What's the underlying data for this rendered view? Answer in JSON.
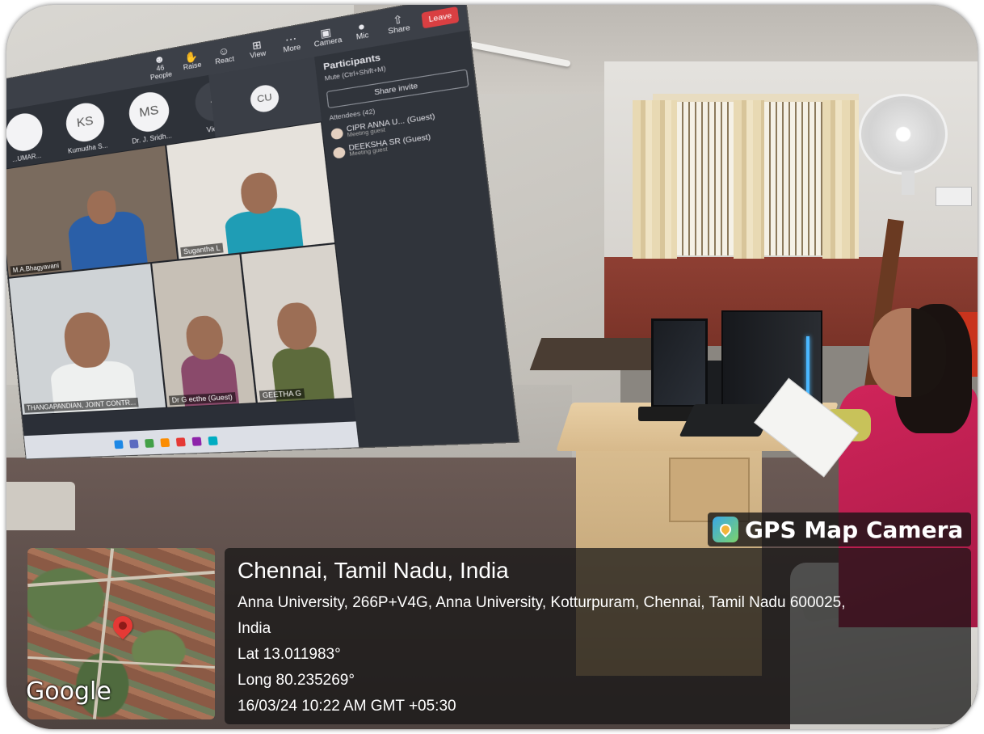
{
  "projected_meeting": {
    "toolbar": {
      "people": "People",
      "people_count": "46",
      "raise": "Raise",
      "react": "React",
      "view": "View",
      "more": "More",
      "camera": "Camera",
      "mic": "Mic",
      "share": "Share",
      "leave": "Leave"
    },
    "avatars": [
      {
        "initials": "",
        "name": "...UMAR..."
      },
      {
        "initials": "KS",
        "name": "Kumudha S..."
      },
      {
        "initials": "MS",
        "name": "Dr. J. Sridh..."
      },
      {
        "initials": "···",
        "name": "View all"
      }
    ],
    "cu_initials": "CU",
    "video_tiles": [
      {
        "label": "M.A.Bhagyavani"
      },
      {
        "label": "Sugantha L"
      },
      {
        "label": "THANGAPANDIAN, JOINT CONTR..."
      },
      {
        "label": "Dr G ecthe (Guest)"
      },
      {
        "label": "GEETHA G"
      }
    ],
    "participants": {
      "title": "Participants",
      "tooltip": "Mute (Ctrl+Shift+M)",
      "share_invite": "Share invite",
      "attendees_header": "Attendees (42)",
      "attendees": [
        {
          "name": "CIPR ANNA U... (Guest)",
          "role": "Meeting guest"
        },
        {
          "name": "DEEKSHA SR (Guest)",
          "role": "Meeting guest"
        }
      ]
    }
  },
  "gps_overlay": {
    "badge": "GPS Map Camera",
    "city": "Chennai, Tamil Nadu, India",
    "address_line1": "Anna University, 266P+V4G, Anna University, Kotturpuram, Chennai, Tamil Nadu 600025,",
    "address_line2": "India",
    "lat": "Lat 13.011983°",
    "long": "Long 80.235269°",
    "timestamp": "16/03/24 10:22 AM GMT +05:30",
    "map_logo": "Google"
  },
  "colors": {
    "curtain": "#e8d9b3",
    "dado": "#8e3f33",
    "kurta": "#d0245a",
    "leave_button": "#d93f42",
    "map_pin": "#e53935"
  }
}
